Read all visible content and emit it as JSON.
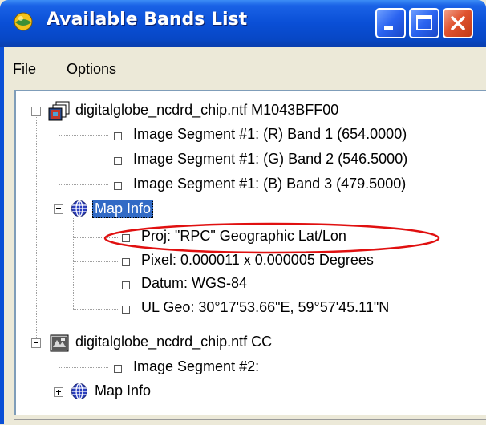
{
  "window": {
    "title": "Available Bands List",
    "controls": {
      "minimize": "minimize",
      "maximize": "maximize",
      "close": "close"
    },
    "colors": {
      "titlebar": "#0a4fd6",
      "selection": "#316ac5",
      "annotation": "#e01010"
    }
  },
  "menu": {
    "file": "File",
    "options": "Options"
  },
  "tree": {
    "file1": {
      "label": "digitalglobe_ncdrd_chip.ntf   M1043BFF00",
      "icon": "multi-band-image-icon",
      "expanded": true,
      "bands": [
        "Image Segment #1: (R) Band 1 (654.0000)",
        "Image Segment #1: (G) Band 2 (546.5000)",
        "Image Segment #1: (B) Band 3 (479.5000)"
      ],
      "map_info": {
        "label": "Map Info",
        "icon": "globe-icon",
        "expanded": true,
        "selected": true,
        "items": [
          "Proj: \"RPC\" Geographic Lat/Lon",
          "Pixel: 0.000011 x 0.000005 Degrees",
          "Datum: WGS-84",
          "UL Geo: 30°17'53.66\"E, 59°57'45.11\"N"
        ]
      }
    },
    "file2": {
      "label": "digitalglobe_ncdrd_chip.ntf   CC",
      "icon": "grayscale-image-icon",
      "expanded": true,
      "segments": [
        "Image Segment #2:"
      ],
      "map_info": {
        "label": "Map Info",
        "icon": "globe-icon",
        "expanded": false
      }
    }
  },
  "annotation": {
    "shape": "ellipse",
    "highlights": "Proj row"
  }
}
